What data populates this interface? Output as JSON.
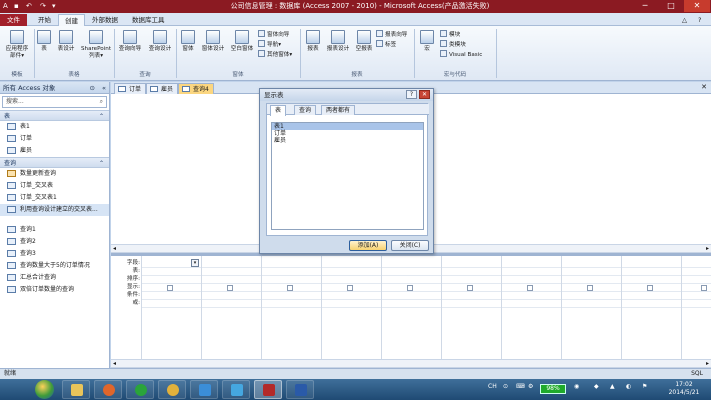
{
  "window": {
    "title": "公司信息管理 : 数据库 (Access 2007 - 2010) - Microsoft Access(产品激活失败)",
    "controls": [
      "─",
      "□",
      "✕"
    ]
  },
  "ribbon_tabs": [
    "文件",
    "开始",
    "创建",
    "外部数据",
    "数据库工具"
  ],
  "ribbon": {
    "templates": {
      "button": "应用程序\n部件▾",
      "group": "模板"
    },
    "tables": {
      "buttons": [
        "表",
        "表设计",
        "SharePoint\n列表▾"
      ],
      "group": "表格"
    },
    "queries": {
      "buttons": [
        "查询向导",
        "查询设计"
      ],
      "group": "查询"
    },
    "forms": {
      "buttons": [
        "窗体",
        "窗体设计",
        "空白窗体"
      ],
      "small": [
        "窗体向导",
        "导航▾",
        "其他窗体▾"
      ],
      "group": "窗体"
    },
    "reports": {
      "buttons": [
        "报表",
        "报表设计",
        "空报表"
      ],
      "small": [
        "报表向导",
        "标签"
      ],
      "group": "报表"
    },
    "macros": {
      "buttons": [
        "宏"
      ],
      "small": [
        "模块",
        "类模块",
        "Visual Basic"
      ],
      "group": "宏与代码"
    }
  },
  "nav": {
    "header": "所有 Access 对象",
    "search_placeholder": "搜索...",
    "sections": [
      {
        "title": "表",
        "items": [
          "表1",
          "订单",
          "雇员"
        ]
      },
      {
        "title": "查询",
        "items": [
          "数量更新查询",
          "订单_交叉表",
          "订单_交叉表1",
          "利用查询设计建立的交叉表...",
          "查询1",
          "查询2",
          "查询3",
          "查询数量大于5的订单情况",
          "汇总合计查询",
          "双倍订单数量的查询"
        ]
      }
    ]
  },
  "doc_tabs": [
    "订单",
    "雇员",
    "查询4"
  ],
  "grid_rows": [
    "字段:",
    "表:",
    "排序:",
    "显示:",
    "条件:",
    "或:"
  ],
  "dialog": {
    "title": "显示表",
    "tabs": [
      "表",
      "查询",
      "两者都有"
    ],
    "items": [
      "表1",
      "订单",
      "雇员"
    ],
    "add_button": "添加(A)",
    "close_button": "关闭(C)"
  },
  "status": {
    "text": "就绪",
    "right": "SQL"
  },
  "taskbar": {
    "battery": "98%",
    "lang": "CH",
    "time": "17:02",
    "date": "2014/5/21"
  }
}
